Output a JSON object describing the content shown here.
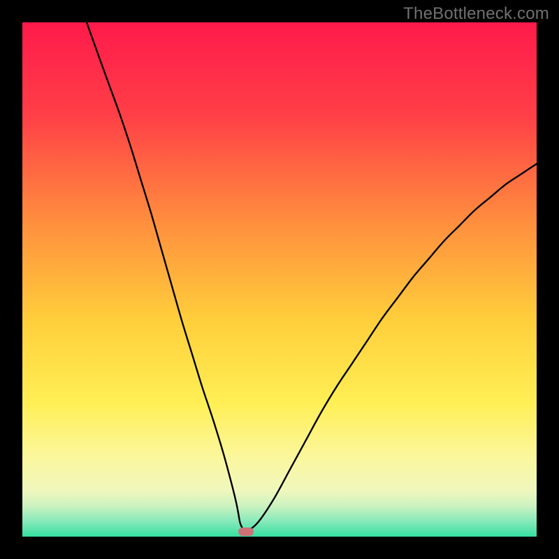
{
  "watermark": "TheBottleneck.com",
  "chart_data": {
    "type": "line",
    "title": "",
    "xlabel": "",
    "ylabel": "",
    "xlim": [
      0,
      100
    ],
    "ylim": [
      0,
      100
    ],
    "gradient_stops": [
      {
        "offset": 0,
        "color": "#ff1a4b"
      },
      {
        "offset": 18,
        "color": "#ff3f47"
      },
      {
        "offset": 38,
        "color": "#ff8b3e"
      },
      {
        "offset": 58,
        "color": "#ffcf3b"
      },
      {
        "offset": 74,
        "color": "#ffef55"
      },
      {
        "offset": 85,
        "color": "#fbf7a0"
      },
      {
        "offset": 91,
        "color": "#f0f7bc"
      },
      {
        "offset": 94,
        "color": "#ccf2c0"
      },
      {
        "offset": 97,
        "color": "#87e9ba"
      },
      {
        "offset": 100,
        "color": "#35dfa0"
      }
    ],
    "series": [
      {
        "name": "bottleneck-curve",
        "x": [
          12.5,
          15,
          17,
          19,
          21,
          23,
          25,
          27,
          29,
          31,
          33,
          35,
          37,
          39,
          40.5,
          41.5,
          42,
          42.3,
          42.8,
          43.2,
          44,
          46,
          49,
          52,
          55,
          58,
          61,
          64,
          67,
          70,
          73,
          76,
          79,
          82,
          85,
          88,
          91,
          94,
          97,
          100
        ],
        "y": [
          100,
          93,
          87.5,
          82,
          76,
          69.5,
          63,
          56,
          49,
          42,
          35.5,
          29,
          23,
          16.5,
          11,
          7,
          4.5,
          2.8,
          1.6,
          1.2,
          1.2,
          3,
          7.5,
          13,
          18.5,
          24,
          29,
          33.5,
          38,
          42.5,
          46.5,
          50.5,
          54,
          57.5,
          60.5,
          63.5,
          66,
          68.5,
          70.5,
          72.5
        ]
      }
    ],
    "marker": {
      "x": 43.5,
      "y": 1.0,
      "color": "#cd7277"
    }
  }
}
